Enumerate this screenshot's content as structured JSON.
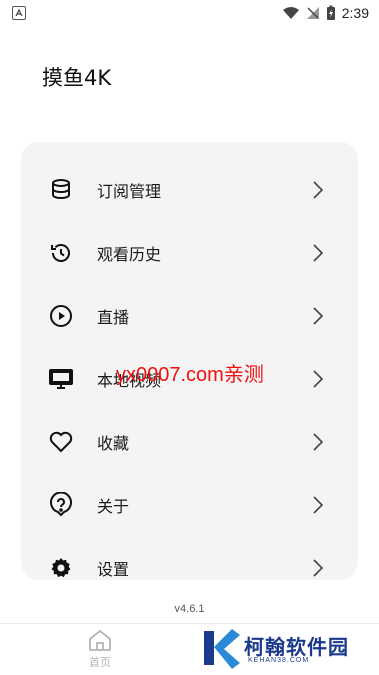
{
  "status_bar": {
    "time": "2:39"
  },
  "header": {
    "title": "摸鱼4K"
  },
  "menu": {
    "items": [
      {
        "label": "订阅管理",
        "icon": "database-icon"
      },
      {
        "label": "观看历史",
        "icon": "history-icon"
      },
      {
        "label": "直播",
        "icon": "play-circle-icon"
      },
      {
        "label": "本地视频",
        "icon": "monitor-icon"
      },
      {
        "label": "收藏",
        "icon": "heart-icon"
      },
      {
        "label": "关于",
        "icon": "help-icon"
      },
      {
        "label": "设置",
        "icon": "gear-icon"
      }
    ]
  },
  "watermark": "yx0007.com亲测",
  "version": "v4.6.1",
  "bottom_nav": {
    "home_label": "首页"
  },
  "brand": {
    "name": "柯翰软件园",
    "sub": "KEHAN38.COM"
  }
}
